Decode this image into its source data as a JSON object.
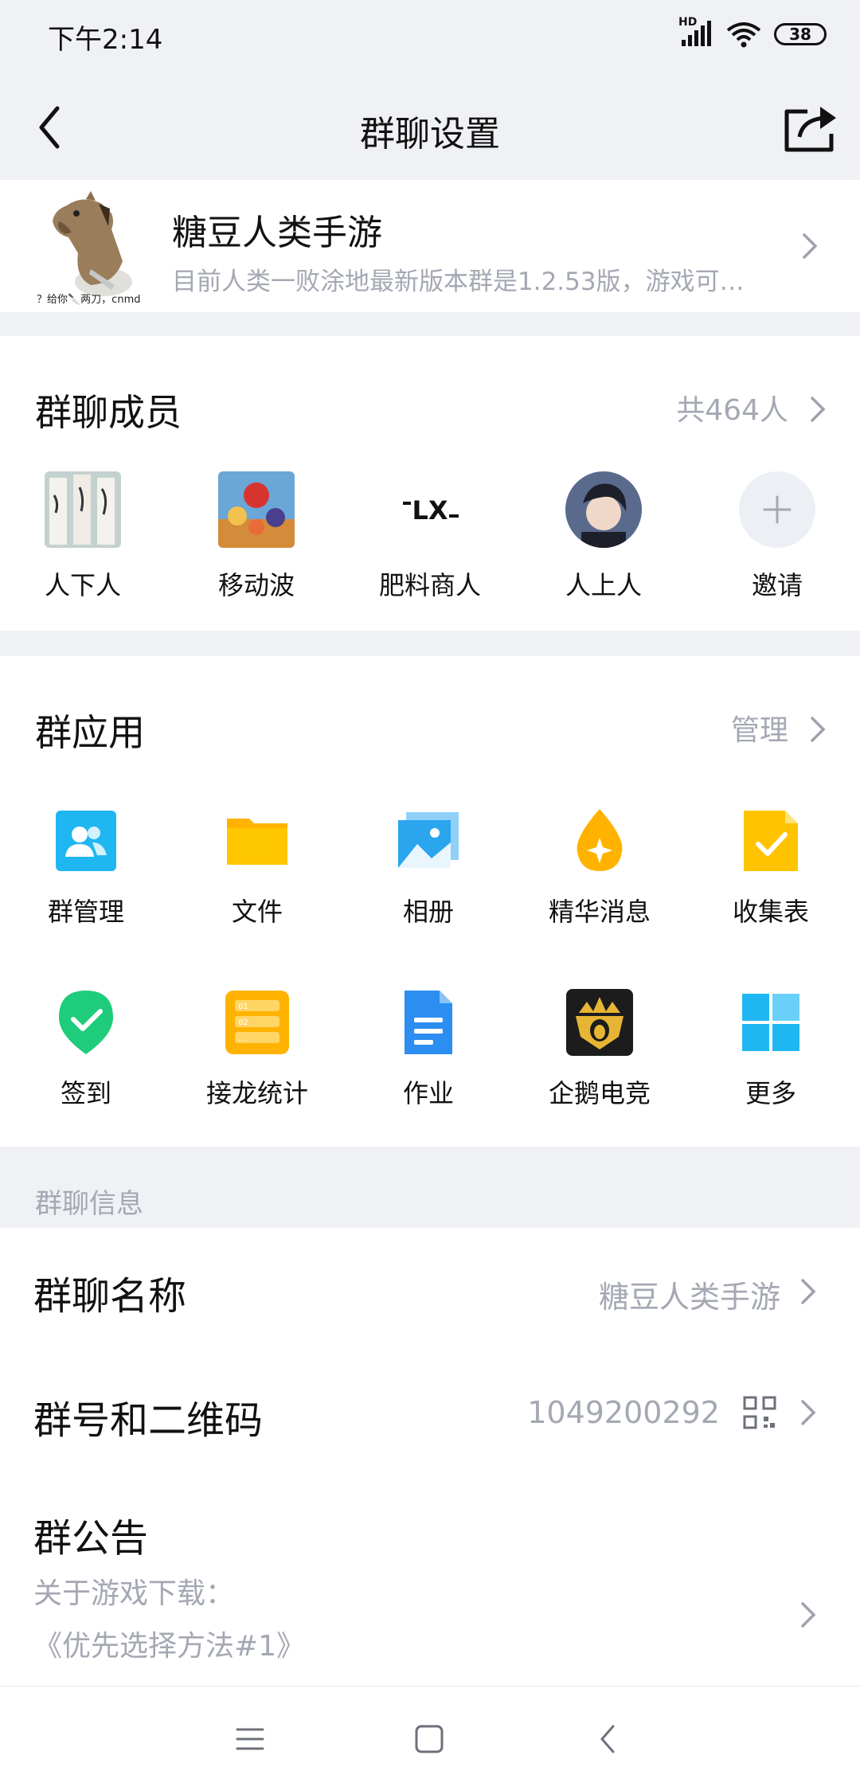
{
  "status_bar": {
    "time": "下午2:14",
    "network": "HD",
    "battery": "38"
  },
  "header": {
    "title": "群聊设置",
    "back_icon": "chevron-left-icon",
    "share_icon": "share-icon"
  },
  "group": {
    "name": "糖豆人类手游",
    "description": "目前人类一败涂地最新版本群是1.2.53版，游戏可…",
    "avatar_caption": "？给你🔪两刀，cnmd"
  },
  "members": {
    "title": "群聊成员",
    "count_label": "共464人",
    "list": [
      {
        "name": "人下人"
      },
      {
        "name": "移动波"
      },
      {
        "name": "肥料商人"
      },
      {
        "name": "人上人"
      },
      {
        "name": "邀请"
      }
    ]
  },
  "apps": {
    "title": "群应用",
    "manage_label": "管理",
    "items": [
      {
        "label": "群管理",
        "icon": "group-manage-icon"
      },
      {
        "label": "文件",
        "icon": "folder-icon"
      },
      {
        "label": "相册",
        "icon": "album-icon"
      },
      {
        "label": "精华消息",
        "icon": "essence-icon"
      },
      {
        "label": "收集表",
        "icon": "form-icon"
      },
      {
        "label": "签到",
        "icon": "checkin-icon"
      },
      {
        "label": "接龙统计",
        "icon": "relay-stats-icon"
      },
      {
        "label": "作业",
        "icon": "homework-icon"
      },
      {
        "label": "企鹅电竞",
        "icon": "penguin-esports-icon"
      },
      {
        "label": "更多",
        "icon": "more-grid-icon"
      }
    ]
  },
  "info": {
    "section_label": "群聊信息",
    "name_row": {
      "label": "群聊名称",
      "value": "糖豆人类手游"
    },
    "number_row": {
      "label": "群号和二维码",
      "value": "1049200292"
    },
    "notice_row": {
      "label": "群公告",
      "line1": "关于游戏下载：",
      "line2": "《优先选择方法#1》"
    }
  },
  "colors": {
    "background": "#eff1f5",
    "secondary_text": "#a4a8b3",
    "accent_blue": "#1fb7f2",
    "accent_yellow": "#ffc300"
  }
}
